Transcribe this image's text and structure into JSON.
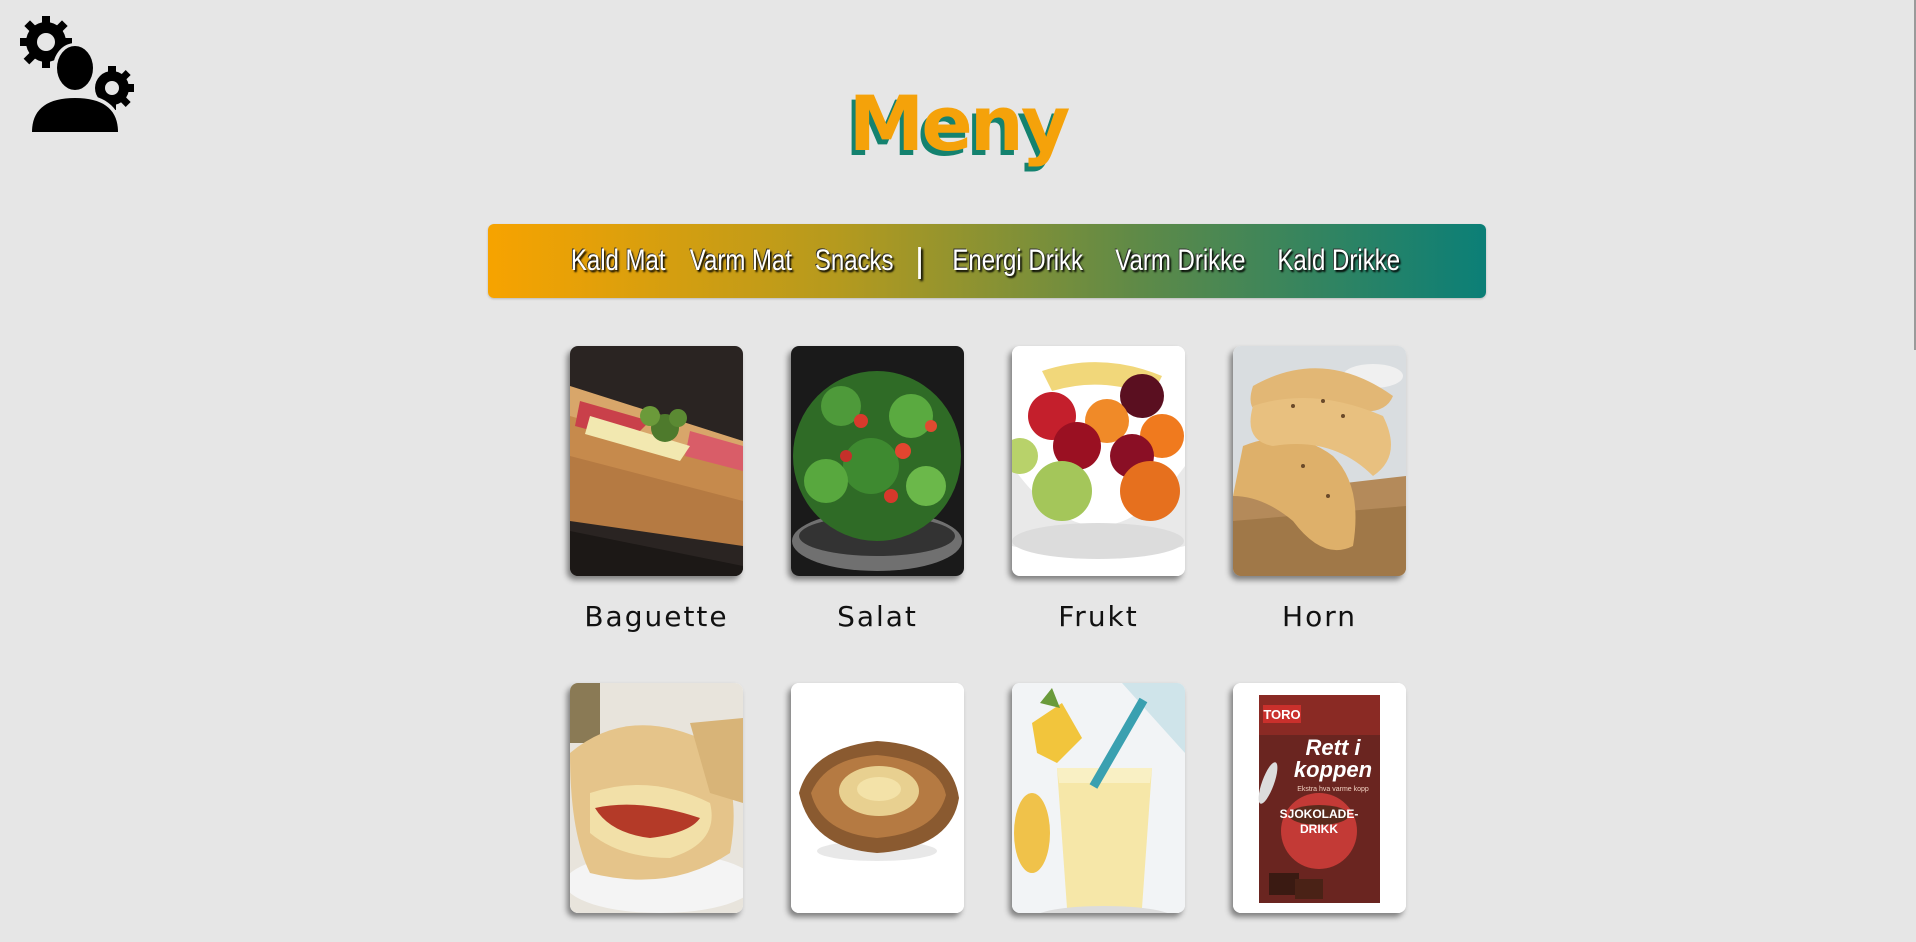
{
  "page": {
    "title": "Meny",
    "admin_icon": "admin-settings-icon"
  },
  "nav": {
    "items": [
      "Kald Mat",
      "Varm Mat",
      "Snacks",
      "Energi Drikk",
      "Varm Drikke",
      "Kald Drikke"
    ],
    "separator": "|"
  },
  "menu": {
    "items": [
      {
        "label": "Baguette",
        "image": "baguette-image"
      },
      {
        "label": "Salat",
        "image": "salad-image"
      },
      {
        "label": "Frukt",
        "image": "fruit-bowl-image"
      },
      {
        "label": "Horn",
        "image": "croissant-image"
      },
      {
        "label": "",
        "image": "calzone-image"
      },
      {
        "label": "",
        "image": "pastry-image"
      },
      {
        "label": "",
        "image": "smoothie-image"
      },
      {
        "label": "",
        "image": "cocoa-packet-image"
      }
    ]
  },
  "packet": {
    "brand": "TORO",
    "name_line1": "Rett i",
    "name_line2": "koppen",
    "tagline": "Ekstra hva varme kopp",
    "flavor_line1": "SJOKOLADE-",
    "flavor_line2": "DRIKK"
  },
  "colors": {
    "accent_orange": "#f7a300",
    "accent_teal": "#0b7f77",
    "background": "#e6e6e6"
  }
}
